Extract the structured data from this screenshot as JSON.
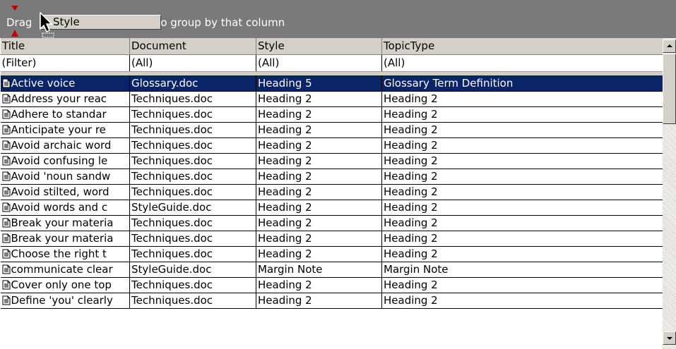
{
  "group_bar": {
    "text_before": "Drag",
    "text_after": "to group by that column",
    "dragged_column": "Style"
  },
  "columns": [
    "Title",
    "Document",
    "Style",
    "TopicType"
  ],
  "filter_row": [
    "(Filter)",
    "(All)",
    "(All)",
    "(All)"
  ],
  "rows": [
    {
      "title": "Active voice",
      "document": "Glossary.doc",
      "style": "Heading 5",
      "topic": "Glossary Term Definition",
      "selected": true
    },
    {
      "title": "Address your reac",
      "document": "Techniques.doc",
      "style": "Heading 2",
      "topic": "Heading 2"
    },
    {
      "title": "Adhere to standar",
      "document": "Techniques.doc",
      "style": "Heading 2",
      "topic": "Heading 2"
    },
    {
      "title": "Anticipate your re",
      "document": "Techniques.doc",
      "style": "Heading 2",
      "topic": "Heading 2"
    },
    {
      "title": "Avoid archaic word",
      "document": "Techniques.doc",
      "style": "Heading 2",
      "topic": "Heading 2"
    },
    {
      "title": "Avoid confusing le",
      "document": "Techniques.doc",
      "style": "Heading 2",
      "topic": "Heading 2"
    },
    {
      "title": "Avoid 'noun sandw",
      "document": "Techniques.doc",
      "style": "Heading 2",
      "topic": "Heading 2"
    },
    {
      "title": "Avoid stilted, word",
      "document": "Techniques.doc",
      "style": "Heading 2",
      "topic": "Heading 2"
    },
    {
      "title": "Avoid words and c",
      "document": "StyleGuide.doc",
      "style": "Heading 2",
      "topic": "Heading 2"
    },
    {
      "title": "Break your materia",
      "document": "Techniques.doc",
      "style": "Heading 2",
      "topic": "Heading 2"
    },
    {
      "title": "Break your materia",
      "document": "Techniques.doc",
      "style": "Heading 2",
      "topic": "Heading 2"
    },
    {
      "title": "Choose the right t",
      "document": "Techniques.doc",
      "style": "Heading 2",
      "topic": "Heading 2"
    },
    {
      "title": "communicate clear",
      "document": "StyleGuide.doc",
      "style": "Margin Note",
      "topic": "Margin Note"
    },
    {
      "title": "Cover only one top",
      "document": "Techniques.doc",
      "style": "Heading 2",
      "topic": "Heading 2"
    },
    {
      "title": "Define 'you' clearly",
      "document": "Techniques.doc",
      "style": "Heading 2",
      "topic": "Heading 2"
    }
  ],
  "icons": {
    "row_icon": "document-icon",
    "drop_markers": "red-triangle-icon",
    "pointer": "mouse-cursor-icon"
  },
  "colors": {
    "group_bar_bg": "#7a7a7a",
    "selection_bg": "#0a246a",
    "header_bg": "#d4d0c8"
  }
}
